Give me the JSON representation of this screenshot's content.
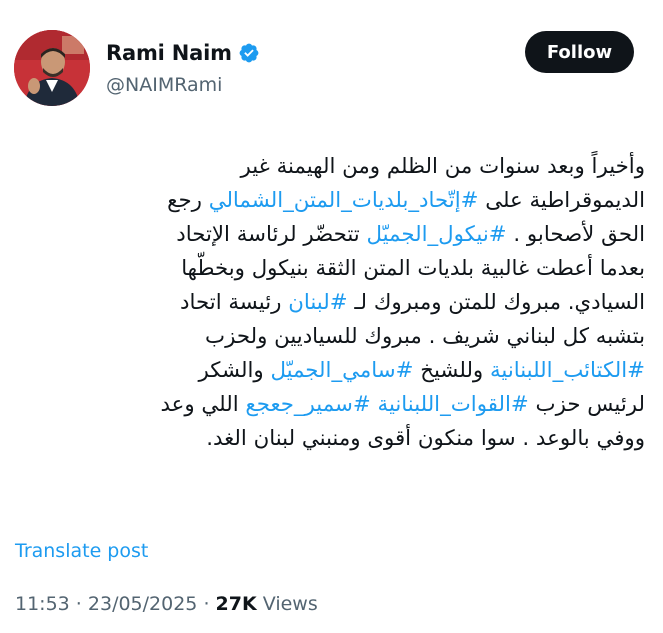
{
  "user": {
    "name": "Rami Naim",
    "handle": "@NAIMRami",
    "follow_label": "Follow"
  },
  "tweet": {
    "lines": [
      [
        {
          "t": "وأخيراً وبعد سنوات من الظلم ومن الهيمنة غير"
        }
      ],
      [
        {
          "t": "الديموقراطية على "
        },
        {
          "t": "#إتّحاد_بلديات_المتن_الشمالي",
          "tag": true
        },
        {
          "t": " رجع"
        }
      ],
      [
        {
          "t": "الحق لأصحابو . "
        },
        {
          "t": "#نيكول_الجميّل",
          "tag": true
        },
        {
          "t": " تتحضّر لرئاسة الإتحاد"
        }
      ],
      [
        {
          "t": "بعدما أعطت غالبية بلديات المتن الثقة بنيكول وبخطّها"
        }
      ],
      [
        {
          "t": "السيادي. مبروك للمتن ومبروك لـ "
        },
        {
          "t": "#لبنان",
          "tag": true
        },
        {
          "t": " رئيسة اتحاد"
        }
      ],
      [
        {
          "t": "بتشبه كل لبناني شريف . مبروك للسياديين ولحزب"
        }
      ],
      [
        {
          "t": "#الكتائب_اللبنانية",
          "tag": true
        },
        {
          "t": " وللشيخ "
        },
        {
          "t": "#سامي_الجميّل",
          "tag": true
        },
        {
          "t": " والشكر"
        }
      ],
      [
        {
          "t": "لرئيس حزب "
        },
        {
          "t": "#القوات_اللبنانية",
          "tag": true
        },
        {
          "t": " "
        },
        {
          "t": "#سمير_جعجع",
          "tag": true
        },
        {
          "t": " اللي وعد"
        }
      ],
      [
        {
          "t": "ووفي بالوعد . سوا منكون أقوى ومنبني لبنان الغد."
        }
      ]
    ]
  },
  "translate_label": "Translate post",
  "meta": {
    "time": "11:53",
    "sep": " · ",
    "date": "23/05/2025",
    "views_count": "27K",
    "views_label": " Views"
  },
  "colors": {
    "accent": "#1d9bf0",
    "text": "#0f1419",
    "muted": "#536471"
  }
}
